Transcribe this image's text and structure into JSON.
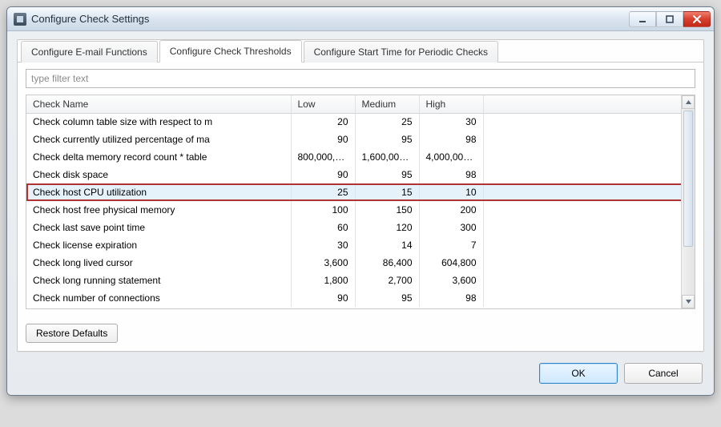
{
  "window": {
    "title": "Configure Check Settings"
  },
  "tabs": [
    {
      "label": "Configure E-mail Functions"
    },
    {
      "label": "Configure Check Thresholds"
    },
    {
      "label": "Configure Start Time for Periodic Checks"
    }
  ],
  "filter": {
    "placeholder": "type filter text"
  },
  "table": {
    "columns": {
      "name": "Check Name",
      "low": "Low",
      "medium": "Medium",
      "high": "High"
    },
    "rows": [
      {
        "name": "Check column table size with respect to m",
        "low": "20",
        "medium": "25",
        "high": "30",
        "selected": false
      },
      {
        "name": "Check currently utilized percentage of ma",
        "low": "90",
        "medium": "95",
        "high": "98",
        "selected": false
      },
      {
        "name": "Check delta memory record count * table",
        "low": "800,000,0...",
        "medium": "1,600,000...",
        "high": "4,000,000...",
        "selected": false
      },
      {
        "name": "Check disk space",
        "low": "90",
        "medium": "95",
        "high": "98",
        "selected": false
      },
      {
        "name": "Check host CPU utilization",
        "low": "25",
        "medium": "15",
        "high": "10",
        "selected": true
      },
      {
        "name": "Check host free physical memory",
        "low": "100",
        "medium": "150",
        "high": "200",
        "selected": false
      },
      {
        "name": "Check last save point time",
        "low": "60",
        "medium": "120",
        "high": "300",
        "selected": false
      },
      {
        "name": "Check license expiration",
        "low": "30",
        "medium": "14",
        "high": "7",
        "selected": false
      },
      {
        "name": "Check long lived cursor",
        "low": "3,600",
        "medium": "86,400",
        "high": "604,800",
        "selected": false
      },
      {
        "name": "Check long running statement",
        "low": "1,800",
        "medium": "2,700",
        "high": "3,600",
        "selected": false
      },
      {
        "name": "Check number of connections",
        "low": "90",
        "medium": "95",
        "high": "98",
        "selected": false
      }
    ]
  },
  "buttons": {
    "restore_defaults": "Restore Defaults",
    "ok": "OK",
    "cancel": "Cancel"
  }
}
